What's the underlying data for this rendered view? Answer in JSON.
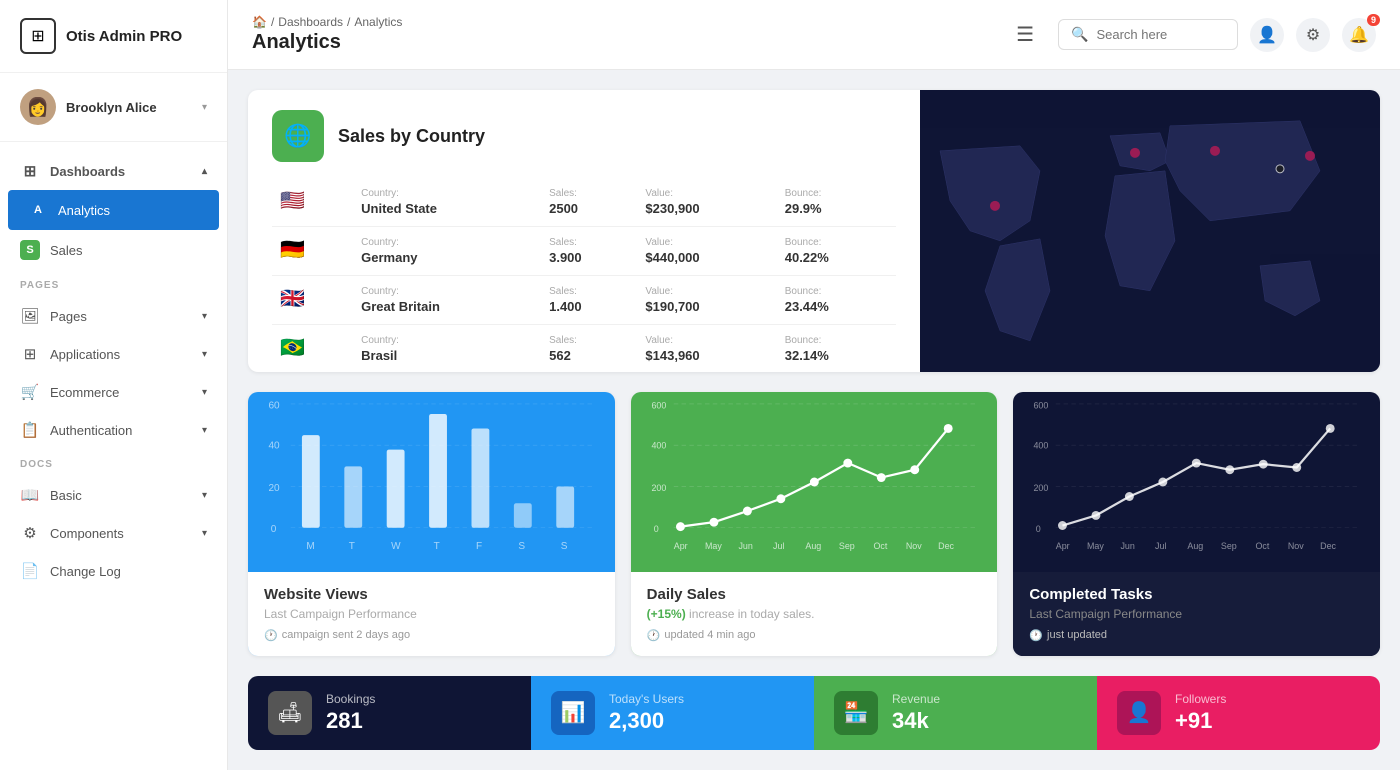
{
  "app": {
    "name": "Otis Admin PRO",
    "logo_icon": "⊞"
  },
  "user": {
    "name": "Brooklyn Alice",
    "avatar_emoji": "👩"
  },
  "sidebar": {
    "sections": [
      {
        "label": "",
        "items": [
          {
            "id": "dashboards",
            "label": "Dashboards",
            "icon": "⊞",
            "has_chevron": true,
            "active": false,
            "type": "parent"
          },
          {
            "id": "analytics",
            "label": "Analytics",
            "letter": "A",
            "letter_color": "blue",
            "active": true,
            "type": "child"
          },
          {
            "id": "sales",
            "label": "Sales",
            "letter": "S",
            "letter_color": "green",
            "active": false,
            "type": "child"
          }
        ]
      },
      {
        "label": "PAGES",
        "items": [
          {
            "id": "pages",
            "label": "Pages",
            "icon": "🖼",
            "has_chevron": true,
            "type": "parent"
          },
          {
            "id": "applications",
            "label": "Applications",
            "icon": "⊞",
            "has_chevron": true,
            "type": "parent"
          },
          {
            "id": "ecommerce",
            "label": "Ecommerce",
            "icon": "🛒",
            "has_chevron": true,
            "type": "parent"
          },
          {
            "id": "authentication",
            "label": "Authentication",
            "icon": "📋",
            "has_chevron": true,
            "type": "parent"
          }
        ]
      },
      {
        "label": "DOCS",
        "items": [
          {
            "id": "basic",
            "label": "Basic",
            "icon": "📖",
            "has_chevron": true,
            "type": "parent"
          },
          {
            "id": "components",
            "label": "Components",
            "icon": "⚙",
            "has_chevron": true,
            "type": "parent"
          },
          {
            "id": "changelog",
            "label": "Change Log",
            "icon": "📄",
            "type": "parent"
          }
        ]
      }
    ]
  },
  "topbar": {
    "breadcrumb": [
      "🏠",
      "Dashboards",
      "Analytics"
    ],
    "page_title": "Analytics",
    "search_placeholder": "Search here",
    "notification_count": "9"
  },
  "sales_by_country": {
    "title": "Sales by Country",
    "icon": "🌐",
    "rows": [
      {
        "flag": "🇺🇸",
        "country_label": "Country:",
        "country": "United State",
        "sales_label": "Sales:",
        "sales": "2500",
        "value_label": "Value:",
        "value": "$230,900",
        "bounce_label": "Bounce:",
        "bounce": "29.9%"
      },
      {
        "flag": "🇩🇪",
        "country_label": "Country:",
        "country": "Germany",
        "sales_label": "Sales:",
        "sales": "3.900",
        "value_label": "Value:",
        "value": "$440,000",
        "bounce_label": "Bounce:",
        "bounce": "40.22%"
      },
      {
        "flag": "🇬🇧",
        "country_label": "Country:",
        "country": "Great Britain",
        "sales_label": "Sales:",
        "sales": "1.400",
        "value_label": "Value:",
        "value": "$190,700",
        "bounce_label": "Bounce:",
        "bounce": "23.44%"
      },
      {
        "flag": "🇧🇷",
        "country_label": "Country:",
        "country": "Brasil",
        "sales_label": "Sales:",
        "sales": "562",
        "value_label": "Value:",
        "value": "$143,960",
        "bounce_label": "Bounce:",
        "bounce": "32.14%"
      }
    ]
  },
  "charts": {
    "website_views": {
      "title": "Website Views",
      "subtitle": "Last Campaign Performance",
      "meta": "campaign sent 2 days ago",
      "y_labels": [
        "60",
        "40",
        "20",
        "0"
      ],
      "x_labels": [
        "M",
        "T",
        "W",
        "T",
        "F",
        "S",
        "S"
      ],
      "bars": [
        45,
        30,
        38,
        55,
        48,
        12,
        20
      ]
    },
    "daily_sales": {
      "title": "Daily Sales",
      "highlight": "(+15%)",
      "subtitle": " increase in today sales.",
      "meta": "updated 4 min ago",
      "y_labels": [
        "600",
        "400",
        "200",
        "0"
      ],
      "x_labels": [
        "Apr",
        "May",
        "Jun",
        "Jul",
        "Aug",
        "Sep",
        "Oct",
        "Nov",
        "Dec"
      ],
      "points": [
        5,
        30,
        80,
        140,
        220,
        320,
        250,
        280,
        480
      ]
    },
    "completed_tasks": {
      "title": "Completed Tasks",
      "subtitle": "Last Campaign Performance",
      "meta": "just updated",
      "y_labels": [
        "600",
        "400",
        "200",
        "0"
      ],
      "x_labels": [
        "Apr",
        "May",
        "Jun",
        "Jul",
        "Aug",
        "Sep",
        "Oct",
        "Nov",
        "Dec"
      ],
      "points": [
        10,
        60,
        150,
        220,
        320,
        280,
        310,
        290,
        480
      ]
    }
  },
  "stats": [
    {
      "id": "bookings",
      "label": "Bookings",
      "value": "281",
      "icon": "🛋",
      "bg": "dark-bg",
      "icon_bg": "gray"
    },
    {
      "id": "today_users",
      "label": "Today's Users",
      "value": "2,300",
      "icon": "📊",
      "bg": "blue-bg",
      "icon_bg": "blue"
    },
    {
      "id": "revenue",
      "label": "Revenue",
      "value": "34k",
      "icon": "🏪",
      "bg": "green-bg",
      "icon_bg": "dkgreen"
    },
    {
      "id": "followers",
      "label": "Followers",
      "value": "+91",
      "icon": "👤",
      "bg": "pink-bg",
      "icon_bg": "darkpink"
    }
  ]
}
